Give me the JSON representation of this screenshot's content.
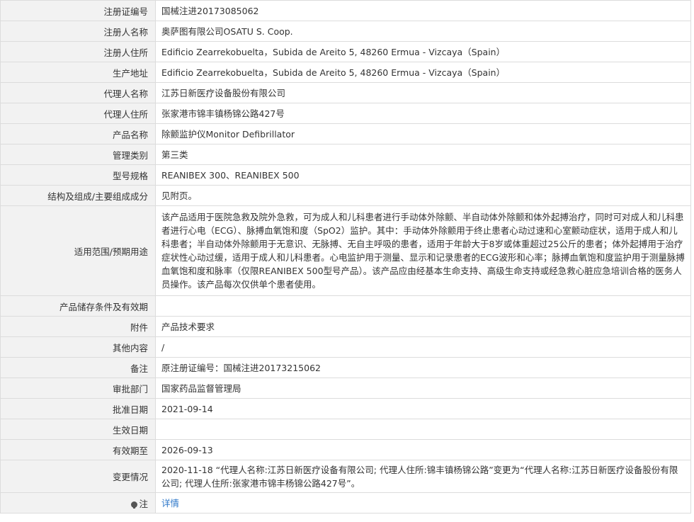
{
  "rows": [
    {
      "label": "注册证编号",
      "value": "国械注进20173085062"
    },
    {
      "label": "注册人名称",
      "value": "奥萨图有限公司OSATU S. Coop."
    },
    {
      "label": "注册人住所",
      "value": "Edificio Zearrekobuelta，Subida de Areito 5, 48260 Ermua - Vizcaya（Spain）"
    },
    {
      "label": "生产地址",
      "value": "Edificio Zearrekobuelta，Subida de Areito 5, 48260 Ermua - Vizcaya（Spain）"
    },
    {
      "label": "代理人名称",
      "value": "江苏日新医疗设备股份有限公司"
    },
    {
      "label": "代理人住所",
      "value": "张家港市锦丰镇杨锦公路427号"
    },
    {
      "label": "产品名称",
      "value": "除颤监护仪Monitor Defibrillator"
    },
    {
      "label": "管理类别",
      "value": "第三类"
    },
    {
      "label": "型号规格",
      "value": "REANIBEX 300、REANIBEX 500"
    },
    {
      "label": "结构及组成/主要组成成分",
      "value": "见附页。"
    },
    {
      "label": "适用范围/预期用途",
      "value": "该产品适用于医院急救及院外急救，可为成人和儿科患者进行手动体外除颤、半自动体外除颤和体外起搏治疗，同时可对成人和儿科患者进行心电（ECG）、脉搏血氧饱和度（SpO2）监护。其中：手动体外除颤用于终止患者心动过速和心室颤动症状，适用于成人和儿科患者；半自动体外除颤用于无意识、无脉搏、无自主呼吸的患者，适用于年龄大于8岁或体重超过25公斤的患者；体外起搏用于治疗症状性心动过缓，适用于成人和儿科患者。心电监护用于测量、显示和记录患者的ECG波形和心率；脉搏血氧饱和度监护用于测量脉搏血氧饱和度和脉率（仅限REANIBEX 500型号产品）。该产品应由经基本生命支持、高级生命支持或经急救心脏应急培训合格的医务人员操作。该产品每次仅供单个患者使用。"
    },
    {
      "label": "产品储存条件及有效期",
      "value": ""
    },
    {
      "label": "附件",
      "value": "产品技术要求"
    },
    {
      "label": "其他内容",
      "value": "/"
    },
    {
      "label": "备注",
      "value": "原注册证编号：国械注进20173215062"
    },
    {
      "label": "审批部门",
      "value": "国家药品监督管理局"
    },
    {
      "label": "批准日期",
      "value": "2021-09-14"
    },
    {
      "label": "生效日期",
      "value": ""
    },
    {
      "label": "有效期至",
      "value": "2026-09-13"
    },
    {
      "label": "变更情况",
      "value": "2020-11-18 “代理人名称:江苏日新医疗设备有限公司; 代理人住所:锦丰镇杨锦公路”变更为“代理人名称:江苏日新医疗设备股份有限公司; 代理人住所:张家港市锦丰杨锦公路427号”。"
    }
  ],
  "note": {
    "label": "注",
    "icon": "lightbulb-icon",
    "link_text": "详情"
  },
  "colors": {
    "label_bg": "#f2f2f2",
    "border": "#dcdcdc",
    "link": "#2d77c9"
  }
}
